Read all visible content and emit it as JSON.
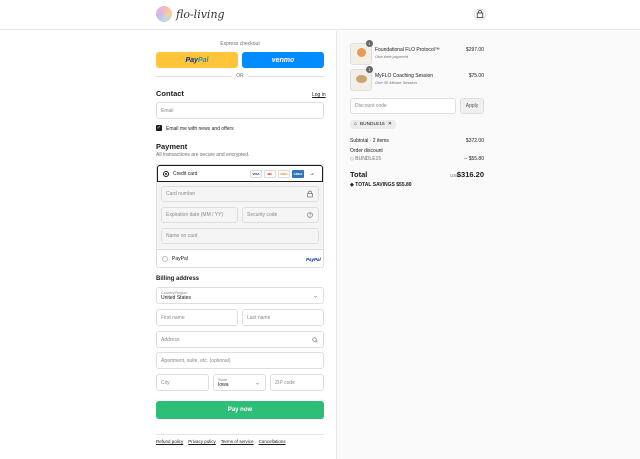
{
  "header": {
    "brand_name": "flo-living",
    "logo_icon": "flo-living-logo-icon",
    "bag_icon": "shopping-bag-icon"
  },
  "express": {
    "label": "Express checkout",
    "paypal_part1": "Pay",
    "paypal_part2": "Pal",
    "venmo_label": "venmo",
    "or_label": "OR"
  },
  "contact": {
    "heading": "Contact",
    "login_link": "Log in",
    "email_placeholder": "Email",
    "newsletter_label": "Email me with news and offers",
    "newsletter_checked": true
  },
  "payment": {
    "heading": "Payment",
    "subtext": "All transactions are secure and encrypted.",
    "credit_card_label": "Credit card",
    "card_brands": [
      "VISA",
      "MC",
      "DISC",
      "AMEX",
      "+2"
    ],
    "card_number_placeholder": "Card number",
    "expiration_placeholder": "Expiration date (MM / YY)",
    "security_placeholder": "Security code",
    "name_placeholder": "Name on card",
    "paypal_label": "PayPal",
    "paypal_logo": "PayPal"
  },
  "billing": {
    "heading": "Billing address",
    "country_label": "Country/Region",
    "country_value": "United States",
    "first_name_placeholder": "First name",
    "last_name_placeholder": "Last name",
    "address_placeholder": "Address",
    "apartment_placeholder": "Apartment, suite, etc. (optional)",
    "city_placeholder": "City",
    "state_label": "State",
    "state_value": "Iowa",
    "zip_placeholder": "ZIP code"
  },
  "pay_now_label": "Pay now",
  "footer": {
    "refund": "Refund policy",
    "privacy": "Privacy policy",
    "terms": "Terms of service",
    "cancellations": "Cancellations"
  },
  "summary": {
    "items": [
      {
        "name": "Foundational FLO Protocol™",
        "subtitle": "One-time payment",
        "price": "$297.00",
        "qty": "1"
      },
      {
        "name": "MyFLO Coaching Session",
        "subtitle": "One 30-Minute Session",
        "price": "$75.00",
        "qty": "1"
      }
    ],
    "discount_placeholder": "Discount code",
    "apply_label": "Apply",
    "applied_code": "BUNDLE15",
    "subtotal_label": "Subtotal · 2 items",
    "subtotal_value": "$372.00",
    "order_discount_label": "Order discount",
    "discount_code": "BUNDLE15",
    "discount_value": "– $55.80",
    "total_label": "Total",
    "currency": "USD",
    "total_value": "$316.20",
    "savings_label": "TOTAL SAVINGS",
    "savings_value": "$55.80"
  },
  "colors": {
    "paypal_yellow": "#ffc439",
    "venmo_blue": "#008cff",
    "pay_green": "#2dbe78"
  }
}
